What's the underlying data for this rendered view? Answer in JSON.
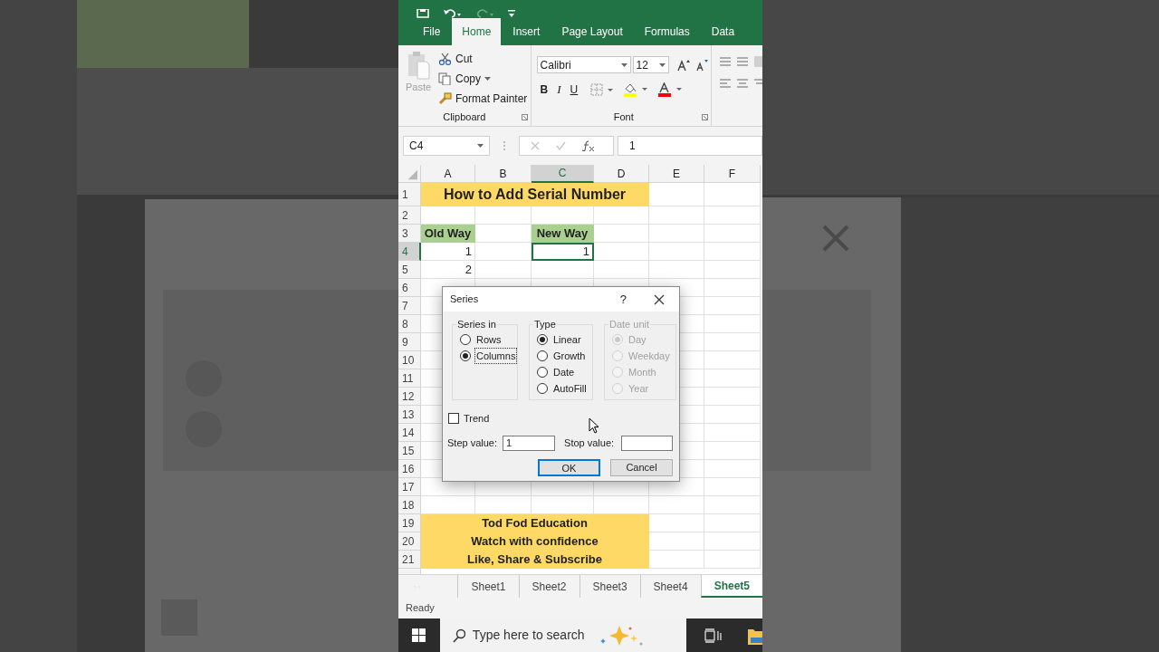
{
  "ribbon_tabs": [
    {
      "label": "File",
      "selected": false
    },
    {
      "label": "Home",
      "selected": true
    },
    {
      "label": "Insert",
      "selected": false
    },
    {
      "label": "Page Layout",
      "selected": false
    },
    {
      "label": "Formulas",
      "selected": false
    },
    {
      "label": "Data",
      "selected": false
    }
  ],
  "clipboard": {
    "paste": "Paste",
    "items": [
      "Cut",
      "Copy",
      "Format Painter"
    ],
    "label": "Clipboard"
  },
  "font_group": {
    "font": "Calibri",
    "size": "12",
    "label": "Font",
    "bold": "B",
    "italic": "I",
    "underline": "U"
  },
  "formula_bar": {
    "name_box": "C4",
    "value": "1"
  },
  "columns": [
    {
      "label": "A",
      "selected": false
    },
    {
      "label": "B",
      "selected": false
    },
    {
      "label": "C",
      "selected": true
    },
    {
      "label": "D",
      "selected": false
    },
    {
      "label": "E",
      "selected": false
    },
    {
      "label": "F",
      "selected": false
    }
  ],
  "rows": [
    {
      "number": "1",
      "selected": false,
      "cells": [
        {
          "text": "How to Add Serial Number",
          "kind": "title",
          "color": "#ffd966",
          "selected": false
        },
        null,
        null
      ]
    },
    {
      "number": "2",
      "selected": false,
      "cells": [
        null,
        null,
        null,
        null,
        null,
        null
      ]
    },
    {
      "number": "3",
      "selected": false,
      "cells": [
        {
          "text": "Old Way",
          "kind": "heading",
          "color": "#a9d08e",
          "selected": false
        },
        null,
        {
          "text": "New Way",
          "kind": "heading",
          "color": "#a9d08e",
          "selected": false
        },
        null,
        null,
        null
      ]
    },
    {
      "number": "4",
      "selected": true,
      "cells": [
        {
          "text": "1",
          "kind": "number",
          "selected": false
        },
        null,
        {
          "text": "1",
          "kind": "number",
          "selected": true
        },
        null,
        null,
        null
      ]
    },
    {
      "number": "5",
      "selected": false,
      "cells": [
        {
          "text": "2",
          "kind": "number",
          "selected": false
        },
        null,
        null,
        null,
        null,
        null
      ]
    },
    {
      "number": "6",
      "selected": false,
      "cells": [
        null,
        null,
        null,
        null,
        null,
        null
      ]
    },
    {
      "number": "7",
      "selected": false,
      "cells": [
        null,
        null,
        null,
        null,
        null,
        null
      ]
    },
    {
      "number": "8",
      "selected": false,
      "cells": [
        null,
        null,
        null,
        null,
        null,
        null
      ]
    },
    {
      "number": "9",
      "selected": false,
      "cells": [
        null,
        null,
        null,
        null,
        null,
        null
      ]
    },
    {
      "number": "10",
      "selected": false,
      "cells": [
        null,
        null,
        null,
        null,
        null,
        null
      ]
    },
    {
      "number": "11",
      "selected": false,
      "cells": [
        null,
        null,
        null,
        null,
        null,
        null
      ]
    },
    {
      "number": "12",
      "selected": false,
      "cells": [
        null,
        null,
        null,
        null,
        null,
        null
      ]
    },
    {
      "number": "13",
      "selected": false,
      "cells": [
        null,
        null,
        null,
        null,
        null,
        null
      ]
    },
    {
      "number": "14",
      "selected": false,
      "cells": [
        null,
        null,
        null,
        null,
        null,
        null
      ]
    },
    {
      "number": "15",
      "selected": false,
      "cells": [
        null,
        null,
        null,
        null,
        null,
        null
      ]
    },
    {
      "number": "16",
      "selected": false,
      "cells": [
        null,
        null,
        null,
        null,
        null,
        null
      ]
    },
    {
      "number": "17",
      "selected": false,
      "cells": [
        null,
        null,
        null,
        null,
        null,
        null
      ]
    },
    {
      "number": "18",
      "selected": false,
      "cells": [
        null,
        null,
        null,
        null,
        null,
        null
      ]
    },
    {
      "number": "19",
      "selected": false,
      "cells": [
        {
          "text": "Tod Fod Education",
          "kind": "banner",
          "color": "#ffd966",
          "selected": false
        },
        null,
        null
      ]
    },
    {
      "number": "20",
      "selected": false,
      "cells": [
        {
          "text": "Watch with confidence",
          "kind": "banner",
          "color": "#ffd966",
          "selected": false
        },
        null,
        null
      ]
    },
    {
      "number": "21",
      "selected": false,
      "cells": [
        {
          "text": "Like, Share & Subscribe",
          "kind": "banner",
          "color": "#ffd966",
          "selected": false
        },
        null,
        null
      ]
    }
  ],
  "dialog": {
    "title": "Series",
    "help": "?",
    "groups": [
      {
        "label": "Series in",
        "disabled": false,
        "options": [
          {
            "label": "Rows",
            "selected": false,
            "focused": false
          },
          {
            "label": "Columns",
            "selected": true,
            "focused": true
          }
        ]
      },
      {
        "label": "Type",
        "disabled": false,
        "options": [
          {
            "label": "Linear",
            "selected": true,
            "focused": false
          },
          {
            "label": "Growth",
            "selected": false,
            "focused": false
          },
          {
            "label": "Date",
            "selected": false,
            "focused": false
          },
          {
            "label": "AutoFill",
            "selected": false,
            "focused": false
          }
        ]
      },
      {
        "label": "Date unit",
        "disabled": true,
        "options": [
          {
            "label": "Day",
            "selected": true,
            "focused": false
          },
          {
            "label": "Weekday",
            "selected": false,
            "focused": false
          },
          {
            "label": "Month",
            "selected": false,
            "focused": false
          },
          {
            "label": "Year",
            "selected": false,
            "focused": false
          }
        ]
      }
    ],
    "trend": {
      "label": "Trend",
      "checked": false
    },
    "step": {
      "label": "Step value:",
      "value": "1"
    },
    "stop": {
      "label": "Stop value:"
    },
    "buttons": [
      {
        "label": "OK",
        "default": true
      },
      {
        "label": "Cancel",
        "default": false
      }
    ]
  },
  "sheet_tabs": [
    {
      "label": "Sheet1",
      "selected": false
    },
    {
      "label": "Sheet2",
      "selected": false
    },
    {
      "label": "Sheet3",
      "selected": false
    },
    {
      "label": "Sheet4",
      "selected": false
    },
    {
      "label": "Sheet5",
      "selected": true
    }
  ],
  "status_bar": {
    "text": "Ready"
  },
  "taskbar": {
    "search_placeholder": "Type here to search"
  }
}
